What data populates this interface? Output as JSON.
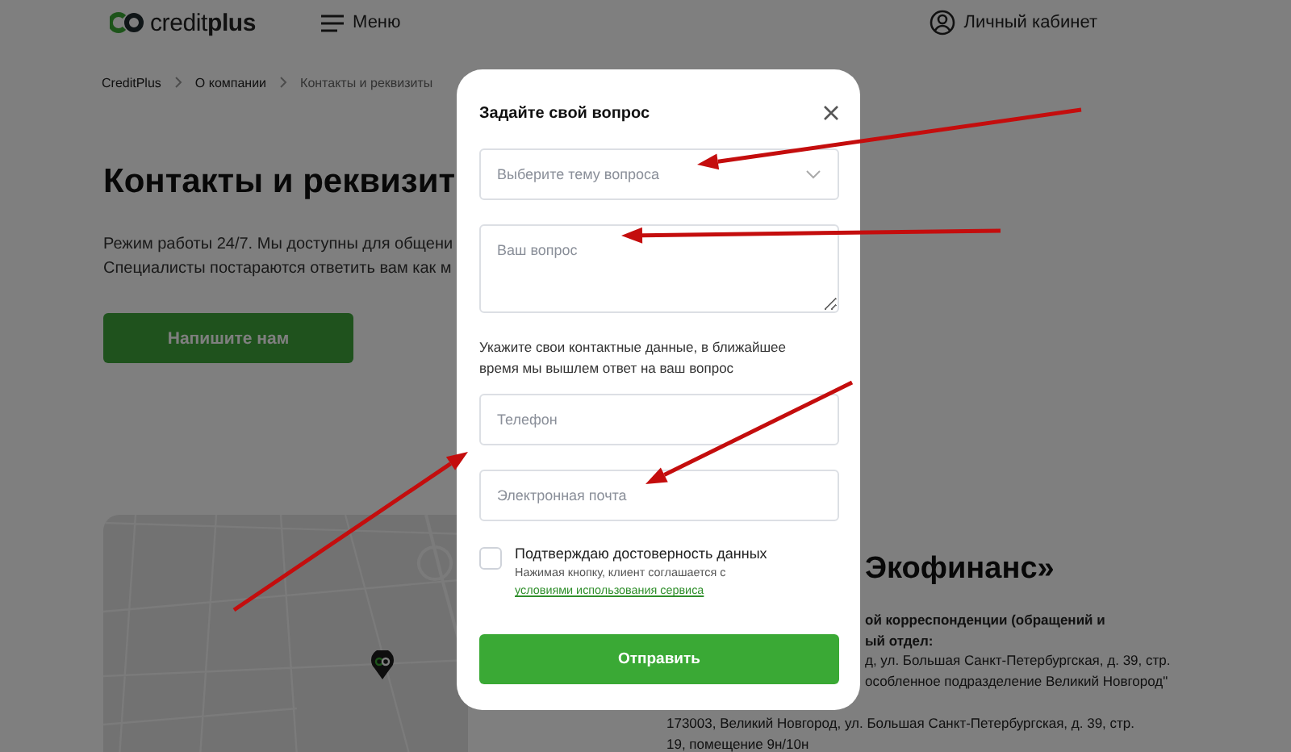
{
  "header": {
    "logo": "credit**plus**",
    "menu_label": "Меню",
    "account_label": "Личный кабинет"
  },
  "breadcrumbs": [
    "CreditPlus",
    "О компании",
    "Контакты и реквизиты"
  ],
  "page": {
    "heading": "Контакты и реквизит",
    "intro": [
      "Режим работы 24/7. Мы доступны для общени",
      "Специалисты постараются ответить вам как м"
    ],
    "write_button": "Напишите нам"
  },
  "company": {
    "heading": "Экофинанс»",
    "partly_hidden_lines": [
      {
        "text": "ой корреспонденции (обращений и",
        "bold": true
      },
      {
        "text": "ый отдел:",
        "bold": true
      },
      {
        "text": "д, ул. Большая Санкт-Петербургская, д. 39, стр.",
        "bold": false
      },
      {
        "text": "особленное подразделение Великий Новгород\"",
        "bold": false
      }
    ],
    "address_lines": [
      {
        "text": "173003, Великий Новгород, ул. Большая Санкт-Петербургская, д. 39, стр.",
        "bold": false
      },
      {
        "text": "19, помещение 9н/10н",
        "bold": false
      }
    ]
  },
  "modal": {
    "title": "Задайте свой вопрос",
    "topic": {
      "placeholder": "Выберите тему вопроса"
    },
    "question": {
      "placeholder": "Ваш вопрос"
    },
    "contact_hint": "Укажите свои контактные данные, в ближайшее время мы вышлем ответ на ваш вопрос",
    "phone": {
      "placeholder": "Телефон"
    },
    "email": {
      "placeholder": "Электронная почта"
    },
    "consent": {
      "checked": false,
      "label": "Подтверждаю достоверность данных",
      "note": "Нажимая кнопку, клиент соглашается с ",
      "link": "условиями использования сервиса"
    },
    "submit": "Отправить"
  }
}
